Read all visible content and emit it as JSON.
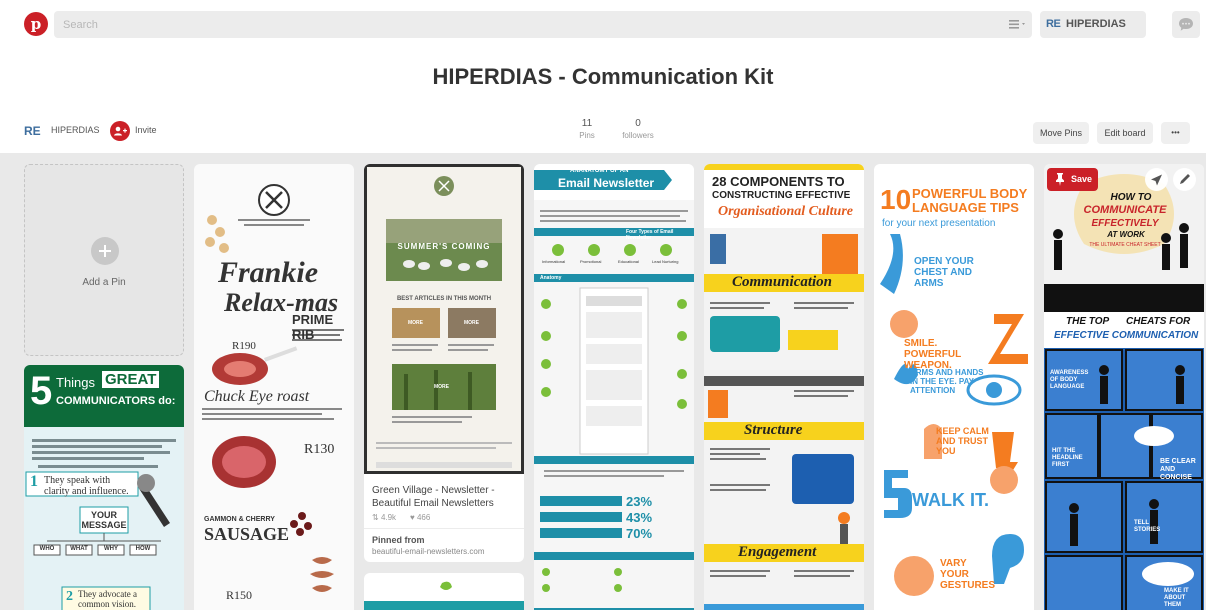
{
  "header": {
    "logo_glyph": "p",
    "search_placeholder": "Search",
    "user_name": "HIPERDIAS",
    "user_logo": "RE",
    "icons": [
      "pinterest-logo",
      "search-icon",
      "menu-filter-icon",
      "chat-bubble-icon"
    ]
  },
  "board": {
    "title": "HIPERDIAS - Communication Kit",
    "owner_name": "HIPERDIAS",
    "owner_logo": "RE",
    "invite_label": "Invite",
    "pins_count": "11",
    "pins_label": "Pins",
    "followers_count": "0",
    "followers_label": "followers",
    "move_pins_label": "Move Pins",
    "edit_board_label": "Edit board",
    "more_label": "•••"
  },
  "add_pin_label": "Add a Pin",
  "pins": {
    "great_communicators": {
      "heading_num": "5",
      "heading_things": "Things",
      "heading_great": "GREAT",
      "heading_rest": "COMMUNICATORS do:",
      "item1": "They speak with clarity and influence.",
      "item1_num": "1",
      "message_box": "YOUR MESSAGE",
      "boxes": [
        "WHO",
        "WHAT",
        "WHY",
        "HOW"
      ],
      "item2": "They advocate a common vision.",
      "item2_num": "2"
    },
    "frankie": {
      "title1": "Frankie",
      "title2": "Relax-mas",
      "prime_rib": "PRIME RIB",
      "price1": "R190",
      "chuck": "Chuck Eye roast",
      "price2": "R130",
      "sausage1": "GAMMON & CHERRY",
      "sausage2": "SAUSAGE",
      "price3": "R150"
    },
    "green_village": {
      "summer": "SUMMER'S COMING",
      "best": "BEST ARTICLES IN THIS MONTH",
      "more1": "MORE",
      "more2": "MORE",
      "more3": "MORE",
      "title": "Green Village - Newsletter - Beautiful Email Newsletters",
      "repins": "4.9k",
      "likes": "466",
      "pinned_from": "Pinned from",
      "source": "beautiful-email-newsletters.com"
    },
    "anatomy": {
      "line1": "ANANATOMY OF AN",
      "line2": "Email Newsletter",
      "types": "Four Types of Email Newsletter",
      "type_labels": [
        "Informational",
        "Promotional",
        "Educational",
        "Lead Nurturing"
      ],
      "anatomy": "Anatomy",
      "pct1": "23%",
      "pct2": "43%",
      "pct3": "70%"
    },
    "culture": {
      "line1": "28 COMPONENTS TO",
      "line2": "CONSTRUCTING EFFECTIVE",
      "line3": "Organisational Culture",
      "communication": "Communication",
      "structure": "Structure",
      "engagement": "Engagement"
    },
    "body_language": {
      "big": "10",
      "line1": "POWERFUL BODY",
      "line2": "LANGUAGE TIPS",
      "line3": "for your next presentation",
      "tip1": "OPEN YOUR CHEST AND ARMS",
      "tip2": "SMILE. POWERFUL WEAPON.",
      "tip3": "ARMS AND HANDS IN THE EYE. PAY ATTENTION",
      "tip4": "KEEP CALM AND TRUST YOU",
      "tip5": "WALK IT.",
      "tip6": "VARY YOUR GESTURES"
    },
    "cheat_sheet": {
      "save_label": "Save",
      "how1": "HOW TO",
      "how2": "COMMUNICATE",
      "how3": "EFFECTIVELY",
      "how4": "AT WORK",
      "how5": "THE ULTIMATE CHEAT SHEET",
      "top6a": "THE TOP",
      "top6b": "CHEATS FOR",
      "top6c": "EFFECTIVE COMMUNICATION",
      "comic1": "AWARENESS OF BODY LANGUAGE",
      "comic2": "BE CLEAR AND CONCISE",
      "comic3": "HIT THE HEADLINE FIRST",
      "comic4": "TELL STORIES",
      "comic5": "MAKE IT ABOUT THEM"
    }
  },
  "colors": {
    "brand_red": "#cb2027",
    "grid_bg": "#e9e9e9",
    "teal": "#1e9da5",
    "green": "#7bbf3a",
    "yellow": "#f7d21d",
    "orange": "#f47c20",
    "comic_blue": "#1d5fb0"
  }
}
